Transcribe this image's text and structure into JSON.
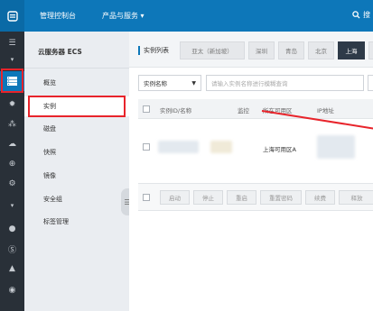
{
  "topbar": {
    "title": "管理控制台",
    "products": "产品与服务 ▾",
    "search": "搜"
  },
  "sidebar": {
    "title": "云服务器 ECS",
    "items": [
      "概览",
      "实例",
      "磁盘",
      "快照",
      "镜像",
      "安全组",
      "标签管理"
    ]
  },
  "main": {
    "list_label": "实例列表",
    "regions": [
      "亚太（新加坡）",
      "深圳",
      "青岛",
      "北京",
      "上海"
    ],
    "active_region": "上海",
    "filter_select": "实例名称",
    "search_placeholder": "请输入实例名称进行模糊查询",
    "columns": [
      "实例ID/名称",
      "监控",
      "所在可用区",
      "IP地址"
    ],
    "row": {
      "zone": "上海可用区A"
    },
    "actions": [
      "启动",
      "停止",
      "重启",
      "重置密码",
      "续费",
      "释放"
    ]
  },
  "colors": {
    "accent": "#0d77b9",
    "highlight": "#e8242b",
    "dark": "#293038"
  }
}
